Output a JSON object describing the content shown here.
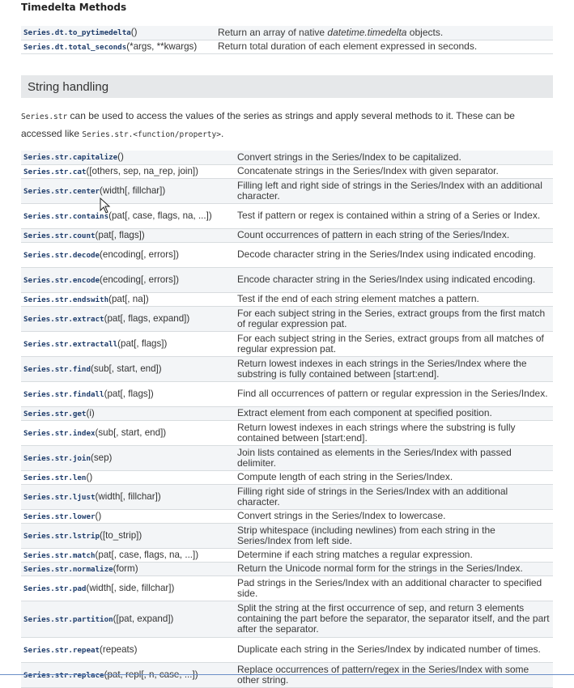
{
  "timedelta": {
    "heading": "Timedelta Methods",
    "rows": [
      {
        "name": "Series.dt.to_pytimedelta",
        "args": "()",
        "desc_pre": "Return an array of native ",
        "desc_em": "datetime.timedelta",
        "desc_post": " objects."
      },
      {
        "name": "Series.dt.total_seconds",
        "args": "(*args, **kwargs)",
        "desc_pre": "Return total duration of each element expressed in seconds.",
        "desc_em": "",
        "desc_post": ""
      }
    ]
  },
  "string_section": {
    "title": "String handling",
    "intro_code1": "Series.str",
    "intro_text1": " can be used to access the values of the series as strings and apply several methods to it. These can be accessed like ",
    "intro_code2": "Series.str.<function/property>",
    "intro_text2": "."
  },
  "methods": [
    {
      "name": "Series.str.capitalize",
      "args": "()",
      "desc": "Convert strings in the Series/Index to be capitalized."
    },
    {
      "name": "Series.str.cat",
      "args": "([others, sep, na_rep, join])",
      "desc": "Concatenate strings in the Series/Index with given separator."
    },
    {
      "name": "Series.str.center",
      "args": "(width[, fillchar])",
      "desc": "Filling left and right side of strings in the Series/Index with an additional character."
    },
    {
      "name": "Series.str.contains",
      "args": "(pat[, case, flags, na, ...])",
      "desc": "Test if pattern or regex is contained within a string of a Series or Index."
    },
    {
      "name": "Series.str.count",
      "args": "(pat[, flags])",
      "desc": "Count occurrences of pattern in each string of the Series/Index."
    },
    {
      "name": "Series.str.decode",
      "args": "(encoding[, errors])",
      "desc": "Decode character string in the Series/Index using indicated encoding."
    },
    {
      "name": "Series.str.encode",
      "args": "(encoding[, errors])",
      "desc": "Encode character string in the Series/Index using indicated encoding."
    },
    {
      "name": "Series.str.endswith",
      "args": "(pat[, na])",
      "desc": "Test if the end of each string element matches a pattern."
    },
    {
      "name": "Series.str.extract",
      "args": "(pat[, flags, expand])",
      "desc": "For each subject string in the Series, extract groups from the first match of regular expression pat."
    },
    {
      "name": "Series.str.extractall",
      "args": "(pat[, flags])",
      "desc": "For each subject string in the Series, extract groups from all matches of regular expression pat."
    },
    {
      "name": "Series.str.find",
      "args": "(sub[, start, end])",
      "desc": "Return lowest indexes in each strings in the Series/Index where the substring is fully contained between [start:end]."
    },
    {
      "name": "Series.str.findall",
      "args": "(pat[, flags])",
      "desc": "Find all occurrences of pattern or regular expression in the Series/Index."
    },
    {
      "name": "Series.str.get",
      "args": "(i)",
      "desc": "Extract element from each component at specified position."
    },
    {
      "name": "Series.str.index",
      "args": "(sub[, start, end])",
      "desc": "Return lowest indexes in each strings where the substring is fully contained between [start:end]."
    },
    {
      "name": "Series.str.join",
      "args": "(sep)",
      "desc": "Join lists contained as elements in the Series/Index with passed delimiter."
    },
    {
      "name": "Series.str.len",
      "args": "()",
      "desc": "Compute length of each string in the Series/Index."
    },
    {
      "name": "Series.str.ljust",
      "args": "(width[, fillchar])",
      "desc": "Filling right side of strings in the Series/Index with an additional character."
    },
    {
      "name": "Series.str.lower",
      "args": "()",
      "desc": "Convert strings in the Series/Index to lowercase."
    },
    {
      "name": "Series.str.lstrip",
      "args": "([to_strip])",
      "desc": "Strip whitespace (including newlines) from each string in the Series/Index from left side."
    },
    {
      "name": "Series.str.match",
      "args": "(pat[, case, flags, na, ...])",
      "desc": "Determine if each string matches a regular expression."
    },
    {
      "name": "Series.str.normalize",
      "args": "(form)",
      "desc": "Return the Unicode normal form for the strings in the Series/Index."
    },
    {
      "name": "Series.str.pad",
      "args": "(width[, side, fillchar])",
      "desc": "Pad strings in the Series/Index with an additional character to specified side."
    },
    {
      "name": "Series.str.partition",
      "args": "([pat, expand])",
      "desc": "Split the string at the first occurrence of sep, and return 3 elements containing the part before the separator, the separator itself, and the part after the separator."
    },
    {
      "name": "Series.str.repeat",
      "args": "(repeats)",
      "desc": "Duplicate each string in the Series/Index by indicated number of times."
    },
    {
      "name": "Series.str.replace",
      "args": "(pat, repl[, n, case, ...])",
      "desc": "Replace occurrences of pattern/regex in the Series/Index with some other string."
    }
  ],
  "colors": {
    "link": "#1f3d6b",
    "section_bg": "#e6e8ea",
    "row_alt": "#f3f5f7"
  }
}
